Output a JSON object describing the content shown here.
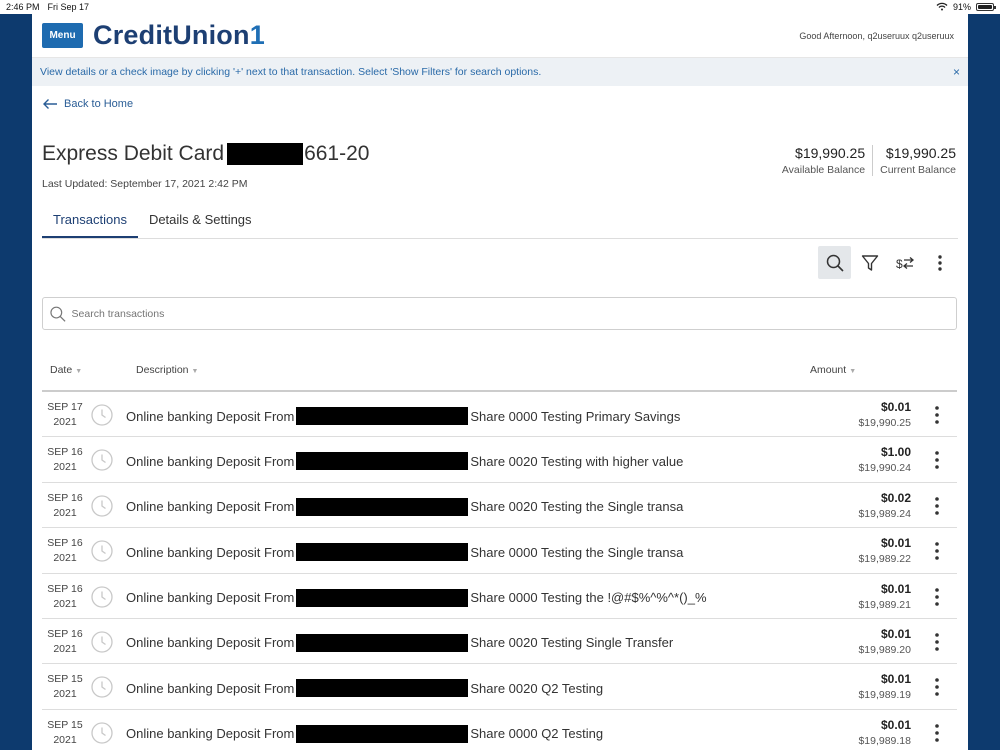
{
  "status_bar": {
    "time": "2:46 PM",
    "date": "Fri Sep 17",
    "battery": "91%"
  },
  "header": {
    "menu_label": "Menu",
    "logo_text_main": "CreditUnion",
    "logo_text_accent": "1",
    "greeting": "Good Afternoon, q2useruux q2useruux"
  },
  "info_banner": {
    "text": "View details or a check image by clicking '+' next to that transaction. Select 'Show Filters' for search options.",
    "close_label": "×"
  },
  "back_link": "Back to Home",
  "account": {
    "title_prefix": "Express Debit Card",
    "title_suffix": "661-20",
    "last_updated": "Last Updated: September 17, 2021 2:42 PM",
    "available_balance": "$19,990.25",
    "available_label": "Available Balance",
    "current_balance": "$19,990.25",
    "current_label": "Current Balance"
  },
  "tabs": [
    {
      "label": "Transactions"
    },
    {
      "label": "Details & Settings"
    }
  ],
  "toolbar": {
    "icons": [
      "search-icon",
      "filter-icon",
      "sort-icon",
      "more-icon"
    ]
  },
  "search": {
    "placeholder": "Search transactions"
  },
  "table": {
    "headers": {
      "date": "Date",
      "description": "Description",
      "amount": "Amount"
    },
    "rows": [
      {
        "month_day": "SEP 17",
        "year": "2021",
        "desc_prefix": "Online banking Deposit From",
        "desc_suffix": "Share 0000 Testing Primary Savings",
        "amount": "$0.01",
        "balance": "$19,990.25"
      },
      {
        "month_day": "SEP 16",
        "year": "2021",
        "desc_prefix": "Online banking Deposit From",
        "desc_suffix": "Share 0020 Testing with higher value",
        "amount": "$1.00",
        "balance": "$19,990.24"
      },
      {
        "month_day": "SEP 16",
        "year": "2021",
        "desc_prefix": "Online banking Deposit From",
        "desc_suffix": "Share 0020 Testing the Single transa",
        "amount": "$0.02",
        "balance": "$19,989.24"
      },
      {
        "month_day": "SEP 16",
        "year": "2021",
        "desc_prefix": "Online banking Deposit From",
        "desc_suffix": "Share 0000 Testing the Single transa",
        "amount": "$0.01",
        "balance": "$19,989.22"
      },
      {
        "month_day": "SEP 16",
        "year": "2021",
        "desc_prefix": "Online banking Deposit From",
        "desc_suffix": "Share 0000 Testing the !@#$%^%^*()_%",
        "amount": "$0.01",
        "balance": "$19,989.21"
      },
      {
        "month_day": "SEP 16",
        "year": "2021",
        "desc_prefix": "Online banking Deposit From",
        "desc_suffix": "Share 0020 Testing Single Transfer",
        "amount": "$0.01",
        "balance": "$19,989.20"
      },
      {
        "month_day": "SEP 15",
        "year": "2021",
        "desc_prefix": "Online banking Deposit From",
        "desc_suffix": "Share 0020 Q2 Testing",
        "amount": "$0.01",
        "balance": "$19,989.19"
      },
      {
        "month_day": "SEP 15",
        "year": "2021",
        "desc_prefix": "Online banking Deposit From",
        "desc_suffix": "Share 0000 Q2 Testing",
        "amount": "$0.01",
        "balance": "$19,989.18"
      }
    ]
  },
  "colors": {
    "brand": "#1d3f73",
    "accent": "#1f6fb5",
    "background": "#0d3a6e"
  }
}
